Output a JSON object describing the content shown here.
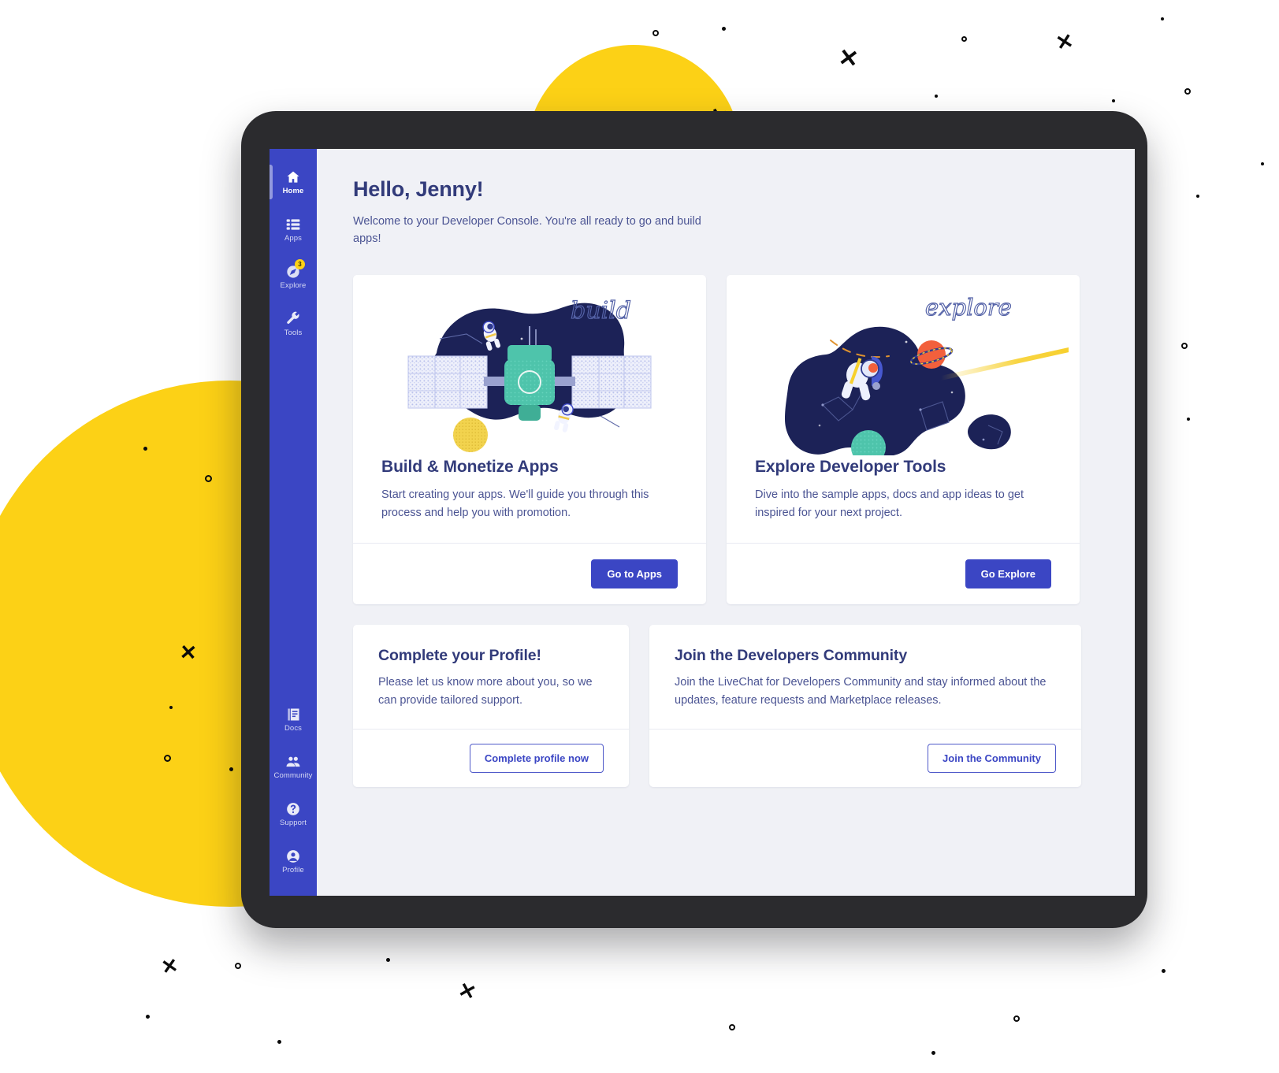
{
  "app": {
    "accent_blue": "#3b46c4",
    "accent_yellow": "#FCD116",
    "text_dark": "#323b7a",
    "text_body": "#4b5493",
    "screen_bg": "#f0f1f6"
  },
  "sidebar": {
    "top_items": [
      {
        "label": "Home",
        "icon": "home-icon",
        "active": true,
        "badge": ""
      },
      {
        "label": "Apps",
        "icon": "apps-list-icon",
        "active": false,
        "badge": ""
      },
      {
        "label": "Explore",
        "icon": "compass-icon",
        "active": false,
        "badge": "3"
      },
      {
        "label": "Tools",
        "icon": "wrench-icon",
        "active": false,
        "badge": ""
      }
    ],
    "bottom_items": [
      {
        "label": "Docs",
        "icon": "docs-icon",
        "active": false,
        "badge": ""
      },
      {
        "label": "Community",
        "icon": "people-icon",
        "active": false,
        "badge": ""
      },
      {
        "label": "Support",
        "icon": "question-circle-icon",
        "active": false,
        "badge": ""
      },
      {
        "label": "Profile",
        "icon": "user-circle-icon",
        "active": false,
        "badge": ""
      }
    ]
  },
  "header": {
    "greeting": "Hello, Jenny!",
    "subtitle": "Welcome to your Developer Console. You're all ready to go and build apps!"
  },
  "cards": {
    "build": {
      "illustration_word": "build",
      "title": "Build & Monetize Apps",
      "text": "Start creating your apps. We'll guide you through this process and help you with promotion.",
      "button": "Go to Apps"
    },
    "explore": {
      "illustration_word": "explore",
      "title": "Explore Developer Tools",
      "text": "Dive into the sample apps, docs and app ideas to get inspired for your next project.",
      "button": "Go Explore"
    },
    "profile": {
      "title": "Complete your Profile!",
      "text": "Please let us know more about you, so we can provide tailored support.",
      "button": "Complete profile now"
    },
    "community": {
      "title": "Join the Developers Community",
      "text": "Join the LiveChat for Developers Community and stay informed about the updates, feature requests and Marketplace releases.",
      "button": "Join the Community"
    }
  }
}
